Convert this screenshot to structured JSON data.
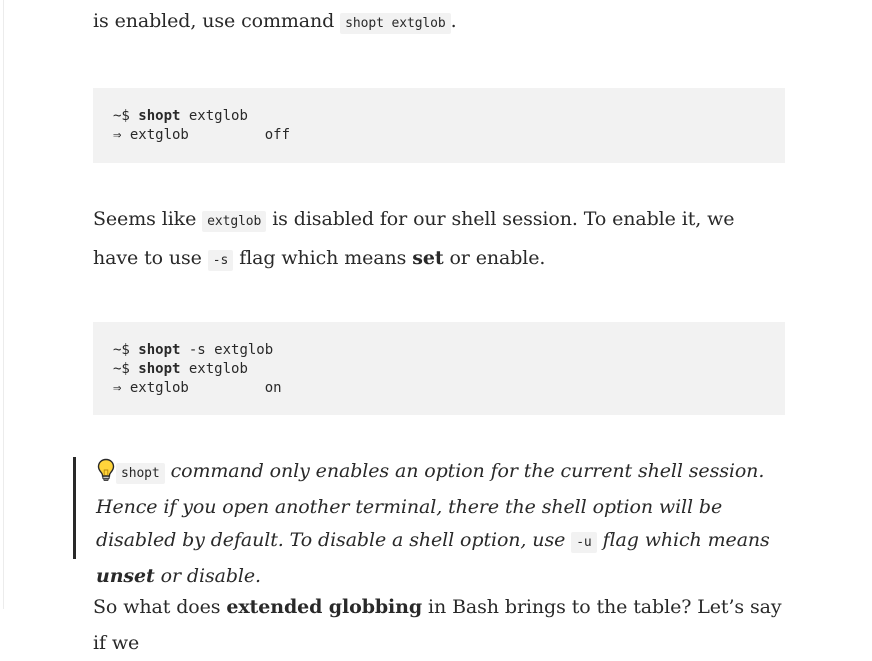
{
  "para1": {
    "prefix": "is enabled, use command ",
    "code": "shopt extglob",
    "suffix": "."
  },
  "codeblock1": {
    "line1": {
      "prompt": "~$ ",
      "cmd": "shopt",
      "args": " extglob"
    },
    "line2": "⇒ extglob         off"
  },
  "para2": {
    "t1": "Seems like ",
    "code1": "extglob",
    "t2": " is disabled for our shell session. To enable it, we have to use ",
    "code2": "-s",
    "t3": " flag which means ",
    "bold": "set",
    "t4": " or enable."
  },
  "codeblock2": {
    "line1": {
      "prompt": "~$ ",
      "cmd": "shopt",
      "args": " -s extglob"
    },
    "line2": {
      "prompt": "~$ ",
      "cmd": "shopt",
      "args": " extglob"
    },
    "line3": "⇒ extglob         on"
  },
  "quote": {
    "icon": "lightbulb-icon",
    "code1": "shopt",
    "t1": " command only enables an option for the current shell session. Hence if you open another terminal, there the shell option will be disabled by default. To disable a shell option, use ",
    "code2": "-u",
    "t2": " flag which means ",
    "bold": "unset",
    "t3": " or disable."
  },
  "para4": {
    "t1": "So what does ",
    "bold": "extended globbing",
    "t2": " in Bash brings to the table? Let’s say if we"
  }
}
